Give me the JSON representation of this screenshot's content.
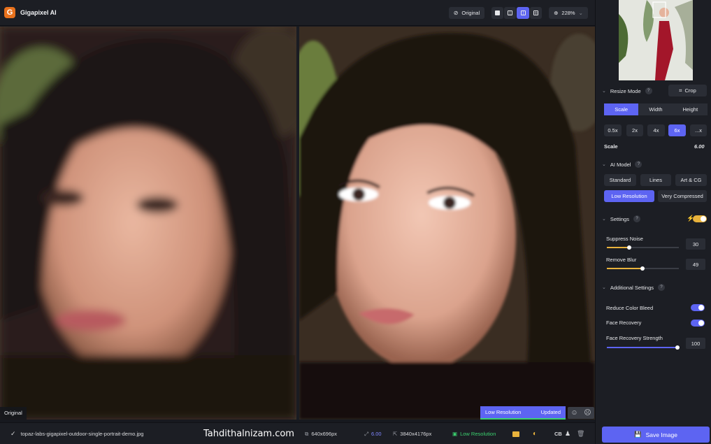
{
  "app": {
    "title": "Gigapixel AI",
    "logo_letter": "G"
  },
  "topbar": {
    "original_label": "Original",
    "zoom": "228%"
  },
  "viewer": {
    "left_label": "Original",
    "status_left": "Low Resolution",
    "status_right": "Updated",
    "progress": 1.0
  },
  "bottombar": {
    "filename": "topaz-labs-gigapixel-outdoor-single-portrait-demo.jpg",
    "input_size": "640x696px",
    "scale": "6.00",
    "output_size": "3840x4176px",
    "model": "Low Resolution",
    "cb_label": "CB",
    "watermark": "Tahdithalnizam.com"
  },
  "sidebar": {
    "resize_mode": {
      "label": "Resize Mode",
      "crop": "Crop",
      "tabs": [
        "Scale",
        "Width",
        "Height"
      ],
      "active_tab": "Scale",
      "scales": [
        "0.5x",
        "2x",
        "4x",
        "6x",
        "...x"
      ],
      "active_scale": "6x",
      "scale_label": "Scale",
      "scale_value": "6.00"
    },
    "ai_model": {
      "label": "AI Model",
      "options": [
        "Standard",
        "Lines",
        "Art & CG",
        "Low Resolution",
        "Very Compressed"
      ],
      "active": "Low Resolution"
    },
    "settings": {
      "label": "Settings",
      "suppress_noise_label": "Suppress Noise",
      "suppress_noise": "30",
      "remove_blur_label": "Remove Blur",
      "remove_blur": "49"
    },
    "additional": {
      "label": "Additional Settings",
      "reduce_color_bleed": "Reduce Color Bleed",
      "face_recovery": "Face Recovery",
      "face_recovery_strength_label": "Face Recovery Strength",
      "face_recovery_strength": "100"
    },
    "save_label": "Save Image"
  },
  "colors": {
    "accent": "#5d64f2",
    "warning": "#e8b23c",
    "success": "#3bd16f",
    "brand": "#e8711c"
  }
}
